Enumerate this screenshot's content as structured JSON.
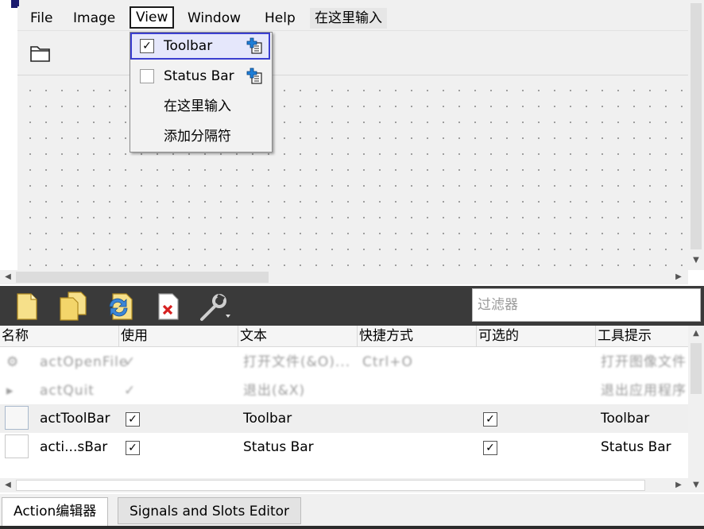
{
  "menubar": {
    "items": [
      "File",
      "Image",
      "View",
      "Window",
      "Help"
    ],
    "placeholder": "在这里输入"
  },
  "toolbar": {
    "open_icon": "folder-icon"
  },
  "view_menu": {
    "items": [
      {
        "label": "Toolbar",
        "checked": true,
        "icon": "add-to-toolbar-icon"
      },
      {
        "label": "Status Bar",
        "checked": false,
        "icon": "add-to-toolbar-icon"
      },
      {
        "label": "在这里输入"
      },
      {
        "label": "添加分隔符"
      }
    ],
    "check_mark": "✓"
  },
  "action_editor": {
    "toolbar_icons": [
      "new-action-icon",
      "copy-action-icon",
      "refresh-action-icon",
      "delete-action-icon",
      "configure-icon"
    ],
    "filter_placeholder": "过滤器",
    "columns": [
      "名称",
      "使用",
      "文本",
      "快捷方式",
      "可选的",
      "工具提示"
    ],
    "rows": [
      {
        "name": "actOpenFile",
        "used": "✓",
        "text": "打开文件(&O)...",
        "shortcut": "Ctrl+O",
        "checkable": "",
        "tooltip": "打开图像文件",
        "blurred": true
      },
      {
        "name": "actQuit",
        "used": "✓",
        "text": "退出(&X)",
        "shortcut": "",
        "checkable": "",
        "tooltip": "退出应用程序",
        "blurred": true
      },
      {
        "name": "actToolBar",
        "used": "✓",
        "text": "Toolbar",
        "shortcut": "",
        "checkable": "✓",
        "tooltip": "Toolbar",
        "blurred": false
      },
      {
        "name": "acti...sBar",
        "used": "✓",
        "text": "Status Bar",
        "shortcut": "",
        "checkable": "✓",
        "tooltip": "Status Bar",
        "blurred": false
      }
    ]
  },
  "tabs": [
    "Action编辑器",
    "Signals and Slots Editor"
  ],
  "colors": {
    "dark_toolbar": "#3a3a3a",
    "menu_highlight": "#3b3fd0",
    "corner_marker": "#1a1a6e"
  }
}
